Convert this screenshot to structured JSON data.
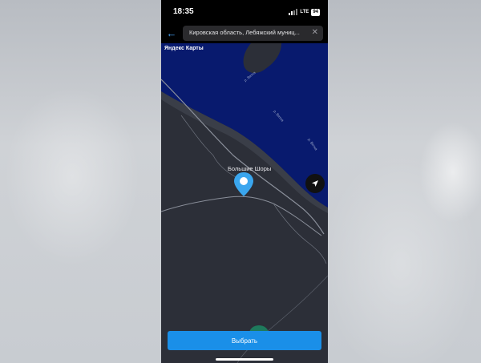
{
  "status_bar": {
    "time": "18:35",
    "network": "LTE",
    "battery": "94"
  },
  "search": {
    "value": "Кировская область, Лебяжский муниц..."
  },
  "map": {
    "brand": "Яндекс Карты",
    "place_label": "Большие Шоры",
    "river_labels": [
      "р. Вятка",
      "р. Вятка",
      "р. Вятка"
    ],
    "colors": {
      "water": "#081a6e",
      "land": "#2c2f38",
      "road": "#8a8f9a",
      "marker": "#3aa6ee"
    }
  },
  "actions": {
    "select_label": "Выбрать"
  },
  "icons": {
    "back": "arrow-left-icon",
    "clear": "close-icon",
    "locate": "navigation-arrow-icon",
    "marker": "map-pin-icon"
  }
}
